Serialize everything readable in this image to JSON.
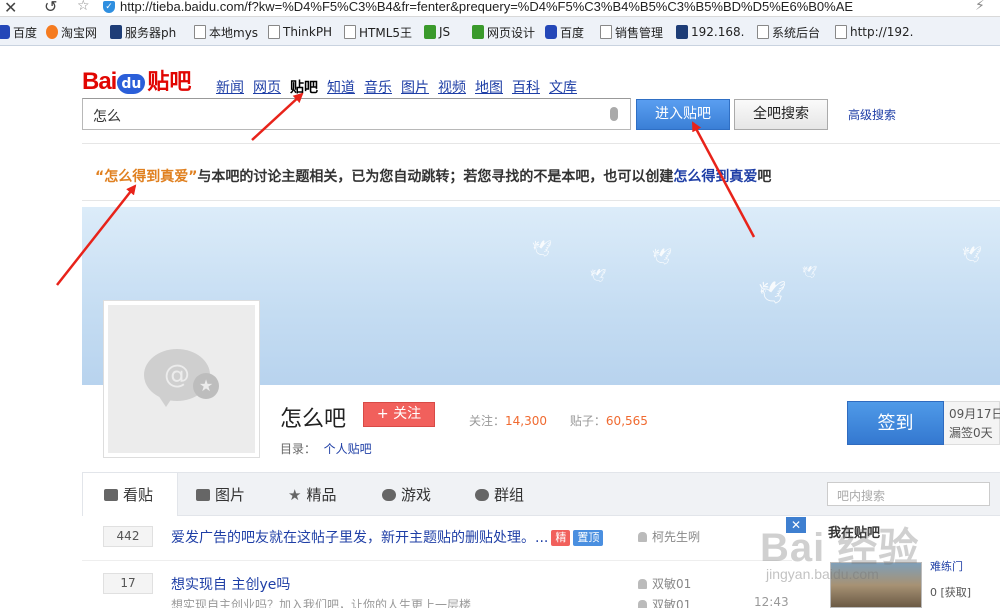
{
  "browser": {
    "url": "http://tieba.baidu.com/f?kw=%D4%F5%C3%B4&fr=fenter&prequery=%D4%F5%C3%B4%B5%C3%B5%BD%D5%E6%B0%AE",
    "bookmarks": [
      {
        "label": "百度",
        "icon": "paw"
      },
      {
        "label": "淘宝网",
        "icon": "taobao"
      },
      {
        "label": "服务器ph",
        "icon": "navy"
      },
      {
        "label": "本地mys",
        "icon": "page"
      },
      {
        "label": "ThinkPH",
        "icon": "page"
      },
      {
        "label": "HTML5王",
        "icon": "page"
      },
      {
        "label": "JS",
        "icon": "green"
      },
      {
        "label": "网页设计",
        "icon": "green"
      },
      {
        "label": "百度",
        "icon": "paw"
      },
      {
        "label": "销售管理",
        "icon": "page"
      },
      {
        "label": "192.168.",
        "icon": "navy"
      },
      {
        "label": "系统后台",
        "icon": "page"
      },
      {
        "label": "http://192.",
        "icon": "page"
      }
    ]
  },
  "header": {
    "logo_bai": "Bai",
    "logo_du": "du",
    "logo_tieba": "贴吧",
    "nav": [
      "新闻",
      "网页",
      "贴吧",
      "知道",
      "音乐",
      "图片",
      "视频",
      "地图",
      "百科",
      "文库"
    ],
    "search_value": "怎么",
    "enter_button": "进入贴吧",
    "all_search_button": "全吧搜索",
    "advanced": "高级搜索"
  },
  "notice": {
    "keyword": "“怎么得到真爱”",
    "text": "与本吧的讨论主题相关，已为您自动跳转；若您寻找的不是本吧，也可以创建",
    "link": "怎么得到真爱",
    "suffix": "吧"
  },
  "forum": {
    "name": "怎么吧",
    "follow_button": "+ 关注",
    "followers_label": "关注：",
    "followers": "14,300",
    "posts_label": "贴子：",
    "posts": "60,565",
    "catalog_label": "目录：",
    "catalog_link": "个人贴吧",
    "sign_button": "签到",
    "sign_date": "09月17日",
    "sign_missed": "漏签0天"
  },
  "tabs": [
    {
      "label": "看贴",
      "icon": "document-icon"
    },
    {
      "label": "图片",
      "icon": "image-icon"
    },
    {
      "label": "精品",
      "icon": "star-icon"
    },
    {
      "label": "游戏",
      "icon": "gamepad-icon"
    },
    {
      "label": "群组",
      "icon": "group-icon"
    }
  ],
  "inner_search_placeholder": "吧内搜索",
  "threads": [
    {
      "replies": "442",
      "title": "爱发广告的吧友就在这帖子里发，新开主题贴的删贴处理。...",
      "badges": [
        "精",
        "置顶"
      ],
      "author": "柯先生咧",
      "sub": "",
      "last": "",
      "time": ""
    },
    {
      "replies": "17",
      "title": "想实现自 主创ye吗",
      "badges": [],
      "author": "双敏01",
      "sub": "想实现自主创业吗？加入我们吧，让你的人生更上一层楼",
      "last": "双敏01",
      "time": "12:43"
    }
  ],
  "right_panel": {
    "title": "我在贴吧",
    "link1": "难练门",
    "link2": "0 [获取]"
  },
  "watermark": {
    "main": "Bai 经验",
    "sub": "jingyan.baidu.com"
  }
}
